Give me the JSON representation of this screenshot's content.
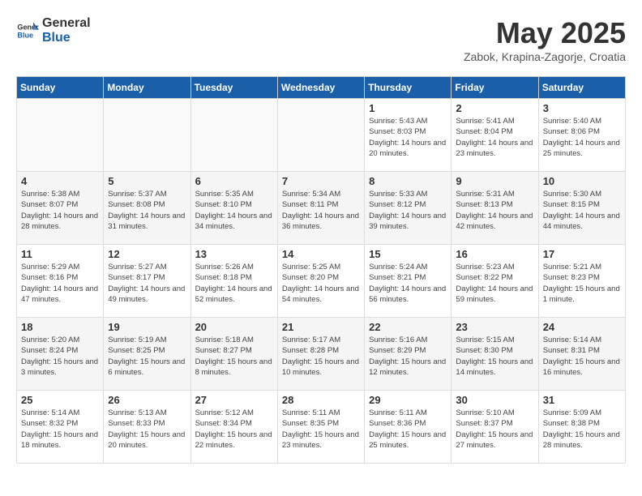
{
  "header": {
    "logo_general": "General",
    "logo_blue": "Blue",
    "month": "May 2025",
    "location": "Zabok, Krapina-Zagorje, Croatia"
  },
  "days_of_week": [
    "Sunday",
    "Monday",
    "Tuesday",
    "Wednesday",
    "Thursday",
    "Friday",
    "Saturday"
  ],
  "weeks": [
    [
      {
        "day": "",
        "info": ""
      },
      {
        "day": "",
        "info": ""
      },
      {
        "day": "",
        "info": ""
      },
      {
        "day": "",
        "info": ""
      },
      {
        "day": "1",
        "info": "Sunrise: 5:43 AM\nSunset: 8:03 PM\nDaylight: 14 hours and 20 minutes."
      },
      {
        "day": "2",
        "info": "Sunrise: 5:41 AM\nSunset: 8:04 PM\nDaylight: 14 hours and 23 minutes."
      },
      {
        "day": "3",
        "info": "Sunrise: 5:40 AM\nSunset: 8:06 PM\nDaylight: 14 hours and 25 minutes."
      }
    ],
    [
      {
        "day": "4",
        "info": "Sunrise: 5:38 AM\nSunset: 8:07 PM\nDaylight: 14 hours and 28 minutes."
      },
      {
        "day": "5",
        "info": "Sunrise: 5:37 AM\nSunset: 8:08 PM\nDaylight: 14 hours and 31 minutes."
      },
      {
        "day": "6",
        "info": "Sunrise: 5:35 AM\nSunset: 8:10 PM\nDaylight: 14 hours and 34 minutes."
      },
      {
        "day": "7",
        "info": "Sunrise: 5:34 AM\nSunset: 8:11 PM\nDaylight: 14 hours and 36 minutes."
      },
      {
        "day": "8",
        "info": "Sunrise: 5:33 AM\nSunset: 8:12 PM\nDaylight: 14 hours and 39 minutes."
      },
      {
        "day": "9",
        "info": "Sunrise: 5:31 AM\nSunset: 8:13 PM\nDaylight: 14 hours and 42 minutes."
      },
      {
        "day": "10",
        "info": "Sunrise: 5:30 AM\nSunset: 8:15 PM\nDaylight: 14 hours and 44 minutes."
      }
    ],
    [
      {
        "day": "11",
        "info": "Sunrise: 5:29 AM\nSunset: 8:16 PM\nDaylight: 14 hours and 47 minutes."
      },
      {
        "day": "12",
        "info": "Sunrise: 5:27 AM\nSunset: 8:17 PM\nDaylight: 14 hours and 49 minutes."
      },
      {
        "day": "13",
        "info": "Sunrise: 5:26 AM\nSunset: 8:18 PM\nDaylight: 14 hours and 52 minutes."
      },
      {
        "day": "14",
        "info": "Sunrise: 5:25 AM\nSunset: 8:20 PM\nDaylight: 14 hours and 54 minutes."
      },
      {
        "day": "15",
        "info": "Sunrise: 5:24 AM\nSunset: 8:21 PM\nDaylight: 14 hours and 56 minutes."
      },
      {
        "day": "16",
        "info": "Sunrise: 5:23 AM\nSunset: 8:22 PM\nDaylight: 14 hours and 59 minutes."
      },
      {
        "day": "17",
        "info": "Sunrise: 5:21 AM\nSunset: 8:23 PM\nDaylight: 15 hours and 1 minute."
      }
    ],
    [
      {
        "day": "18",
        "info": "Sunrise: 5:20 AM\nSunset: 8:24 PM\nDaylight: 15 hours and 3 minutes."
      },
      {
        "day": "19",
        "info": "Sunrise: 5:19 AM\nSunset: 8:25 PM\nDaylight: 15 hours and 6 minutes."
      },
      {
        "day": "20",
        "info": "Sunrise: 5:18 AM\nSunset: 8:27 PM\nDaylight: 15 hours and 8 minutes."
      },
      {
        "day": "21",
        "info": "Sunrise: 5:17 AM\nSunset: 8:28 PM\nDaylight: 15 hours and 10 minutes."
      },
      {
        "day": "22",
        "info": "Sunrise: 5:16 AM\nSunset: 8:29 PM\nDaylight: 15 hours and 12 minutes."
      },
      {
        "day": "23",
        "info": "Sunrise: 5:15 AM\nSunset: 8:30 PM\nDaylight: 15 hours and 14 minutes."
      },
      {
        "day": "24",
        "info": "Sunrise: 5:14 AM\nSunset: 8:31 PM\nDaylight: 15 hours and 16 minutes."
      }
    ],
    [
      {
        "day": "25",
        "info": "Sunrise: 5:14 AM\nSunset: 8:32 PM\nDaylight: 15 hours and 18 minutes."
      },
      {
        "day": "26",
        "info": "Sunrise: 5:13 AM\nSunset: 8:33 PM\nDaylight: 15 hours and 20 minutes."
      },
      {
        "day": "27",
        "info": "Sunrise: 5:12 AM\nSunset: 8:34 PM\nDaylight: 15 hours and 22 minutes."
      },
      {
        "day": "28",
        "info": "Sunrise: 5:11 AM\nSunset: 8:35 PM\nDaylight: 15 hours and 23 minutes."
      },
      {
        "day": "29",
        "info": "Sunrise: 5:11 AM\nSunset: 8:36 PM\nDaylight: 15 hours and 25 minutes."
      },
      {
        "day": "30",
        "info": "Sunrise: 5:10 AM\nSunset: 8:37 PM\nDaylight: 15 hours and 27 minutes."
      },
      {
        "day": "31",
        "info": "Sunrise: 5:09 AM\nSunset: 8:38 PM\nDaylight: 15 hours and 28 minutes."
      }
    ]
  ],
  "colors": {
    "header_bg": "#1a5fa8",
    "header_text": "#ffffff",
    "accent_blue": "#1a5fa8"
  }
}
